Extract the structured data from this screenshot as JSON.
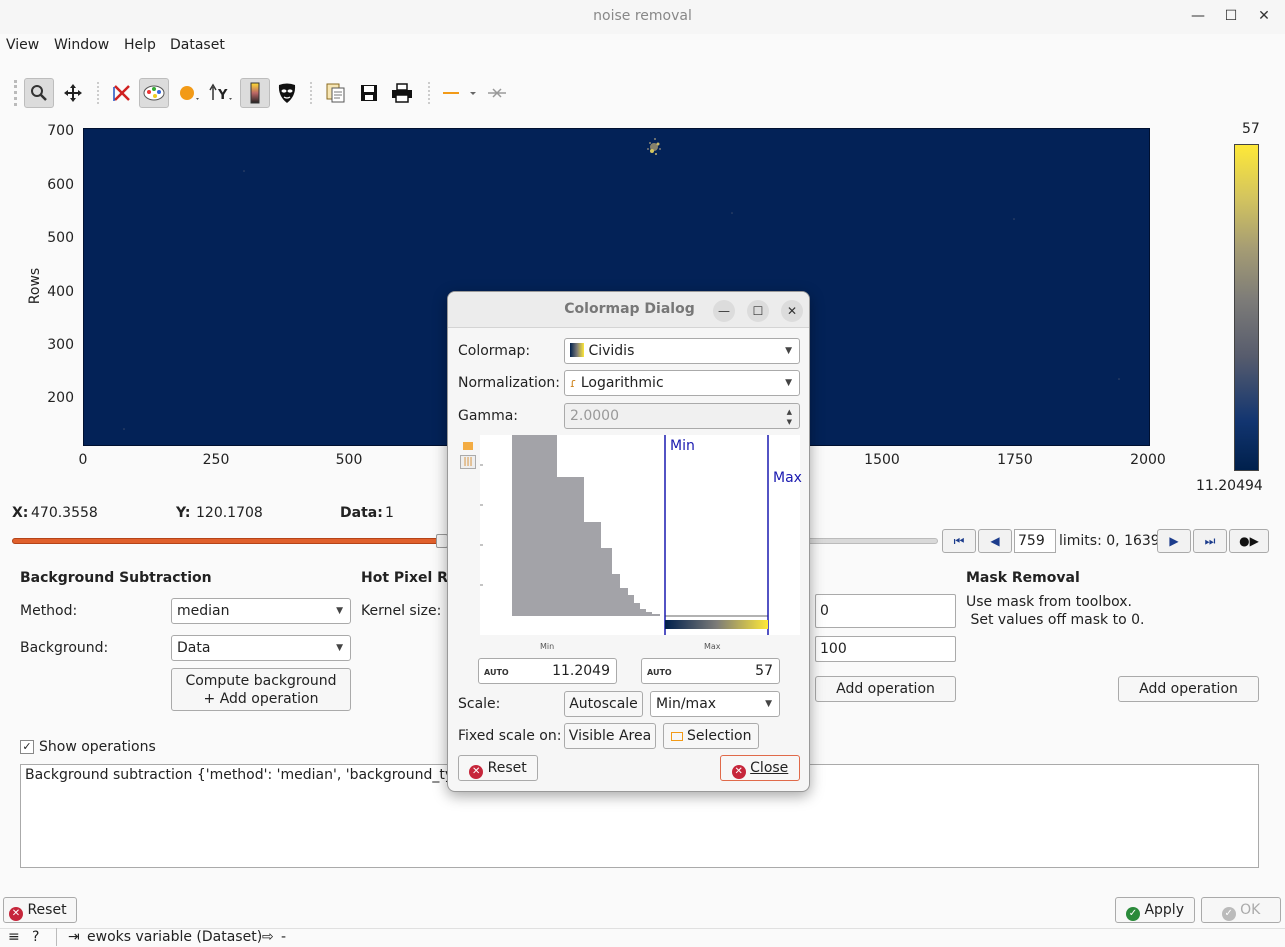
{
  "window": {
    "title": "noise removal",
    "minimize": "—",
    "maximize": "☐",
    "close": "✕"
  },
  "menu": [
    "View",
    "Window",
    "Help",
    "Dataset"
  ],
  "toolbar": {
    "icons": [
      "zoom-icon",
      "pan-icon",
      "reset-zoom-icon",
      "colormap-icon",
      "marker-icon",
      "axis-y-icon",
      "colorbar-icon",
      "mask-icon",
      "copy-icon",
      "save-icon",
      "print-icon",
      "profile-line-icon",
      "clear-profile-icon"
    ]
  },
  "plot": {
    "ylabel": "Rows",
    "yticks": [
      "700",
      "600",
      "500",
      "400",
      "300",
      "200"
    ],
    "xticks": [
      "0",
      "250",
      "500",
      "1500",
      "1750",
      "2000"
    ],
    "colorbar_max": "57",
    "colorbar_min": "11.20494",
    "colormap_colors": [
      "#00204c",
      "#fee838"
    ]
  },
  "coords": {
    "x_label": "X:",
    "x_value": "470.3558",
    "y_label": "Y:",
    "y_value": "120.1708",
    "data_label": "Data:",
    "data_value": "1"
  },
  "frame": {
    "current": "759",
    "limits": "limits: 0, 1639",
    "progress_fraction": 0.463
  },
  "background_subtraction": {
    "title": "Background Subtraction",
    "method_label": "Method:",
    "method_value": "median",
    "background_label": "Background:",
    "background_value": "Data",
    "compute_button": "Compute background\n+ Add operation"
  },
  "hot_pixel": {
    "title": "Hot Pixel Re",
    "kernel_label": "Kernel size:"
  },
  "threshold": {
    "min_value": "0",
    "max_value": "100",
    "add_button": "Add operation"
  },
  "mask_removal": {
    "title": "Mask Removal",
    "desc1": "Use mask from toolbox.",
    "desc2": " Set values off mask to 0.",
    "add_button": "Add operation"
  },
  "operations": {
    "checkbox_label": "Show operations",
    "checked": true,
    "text": "Background subtraction {'method': 'median', 'background_type'"
  },
  "footer": {
    "reset": "Reset",
    "apply": "Apply",
    "ok": "OK",
    "status_var": "ewoks variable (Dataset)",
    "status_out": "-"
  },
  "dialog": {
    "title": "Colormap Dialog",
    "colormap_label": "Colormap:",
    "colormap_value": "Cividis",
    "normalization_label": "Normalization:",
    "normalization_value": "Logarithmic",
    "gamma_label": "Gamma:",
    "gamma_value": "2.0000",
    "hist_min_label": "Min",
    "hist_max_label": "Max",
    "hist_axis_min": "Min",
    "hist_axis_max": "Max",
    "min_mode": "AUTO",
    "min_value": "11.2049",
    "max_mode": "AUTO",
    "max_value": "57",
    "scale_label": "Scale:",
    "autoscale": "Autoscale",
    "scale_mode": "Min/max",
    "fixed_label": "Fixed scale on:",
    "visible_area": "Visible Area",
    "selection": "Selection",
    "reset": "Reset",
    "close": "Close"
  }
}
